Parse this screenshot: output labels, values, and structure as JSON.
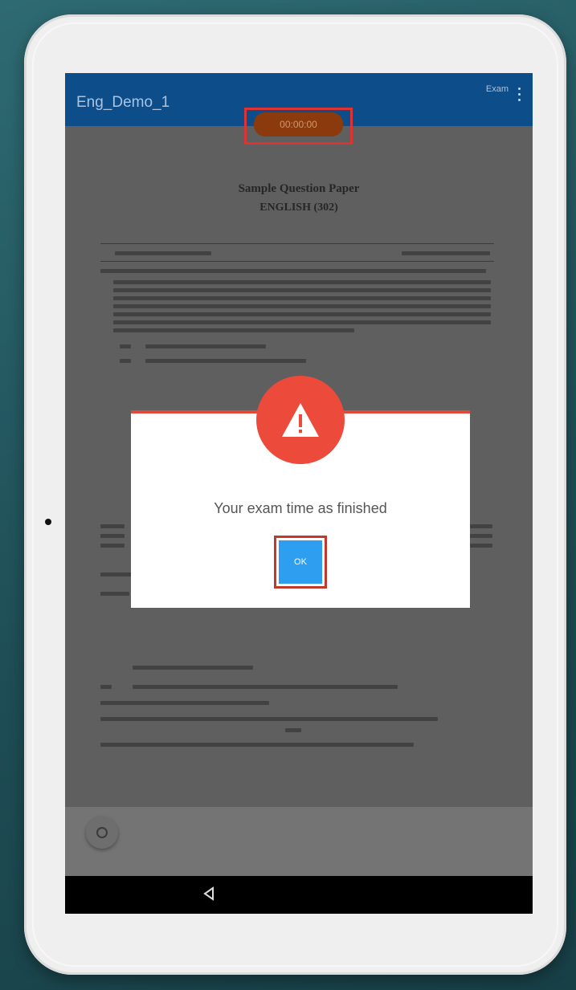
{
  "app": {
    "title": "Eng_Demo_1",
    "header_right": "Exam"
  },
  "timer": {
    "text": "00:00:00"
  },
  "paper": {
    "title": "Sample Question Paper",
    "subtitle": "ENGLISH (302)"
  },
  "dialog": {
    "message": "Your exam time as finished",
    "ok_label": "OK"
  },
  "icons": [
    "more-vert-icon",
    "warning-icon",
    "back-icon",
    "refresh-icon"
  ],
  "colors": {
    "appbar": "#0d4d8a",
    "timer": "#8a3a0c",
    "warning": "#ec4a3a",
    "ok_button": "#2d9ef0",
    "highlight": "#d33333"
  }
}
